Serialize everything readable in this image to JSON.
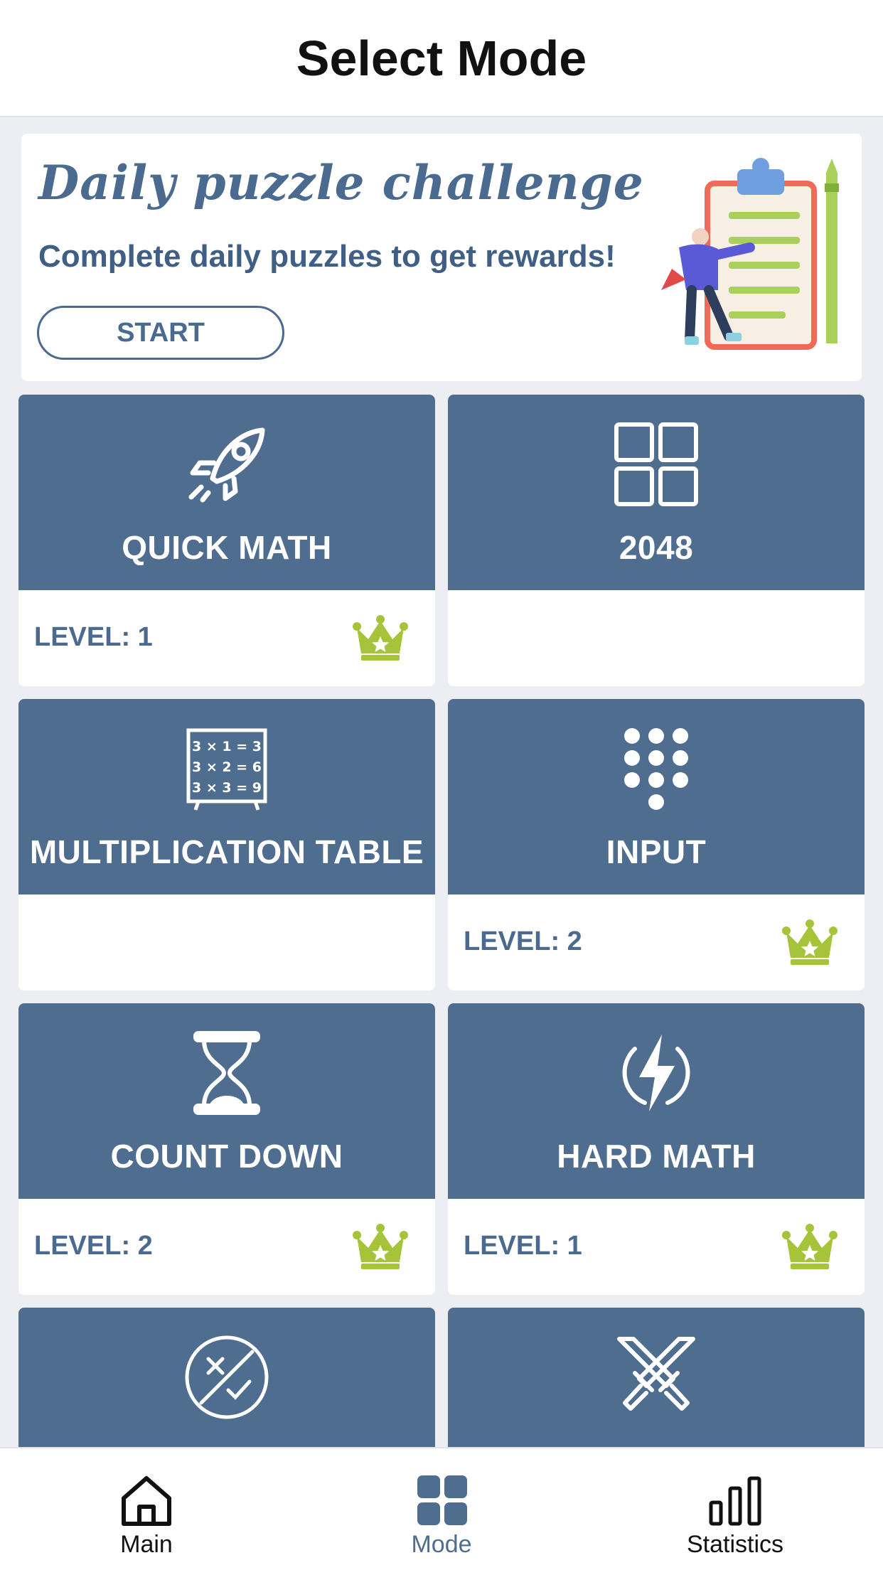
{
  "header": {
    "title": "Select Mode"
  },
  "banner": {
    "title": "Daily puzzle challenge",
    "subtitle": "Complete daily puzzles to get rewards!",
    "start_label": "START"
  },
  "colors": {
    "tile": "#4f6d8f",
    "accent_crown": "#a5c43a",
    "text_blue": "#4a6a8f"
  },
  "modes": [
    {
      "name": "QUICK MATH",
      "icon": "rocket-icon",
      "level": "LEVEL: 1",
      "crown": true
    },
    {
      "name": "2048",
      "icon": "grid-icon",
      "level": "",
      "crown": false
    },
    {
      "name": "MULTIPLICATION TABLE",
      "icon": "multiplication-board-icon",
      "level": "",
      "crown": false
    },
    {
      "name": "INPUT",
      "icon": "keypad-icon",
      "level": "LEVEL: 2",
      "crown": true
    },
    {
      "name": "COUNT DOWN",
      "icon": "hourglass-icon",
      "level": "LEVEL: 2",
      "crown": true
    },
    {
      "name": "HARD MATH",
      "icon": "lightning-icon",
      "level": "LEVEL: 1",
      "crown": true
    },
    {
      "name": "",
      "icon": "true-false-icon",
      "level": "",
      "crown": false
    },
    {
      "name": "",
      "icon": "crossed-swords-icon",
      "level": "",
      "crown": false
    }
  ],
  "board_lines": [
    "3 × 1 = 3",
    "3 × 2 = 6",
    "3 × 3 = 9"
  ],
  "tabs": [
    {
      "label": "Main",
      "icon": "home-icon",
      "active": false
    },
    {
      "label": "Mode",
      "icon": "grid-tiles-icon",
      "active": true
    },
    {
      "label": "Statistics",
      "icon": "bar-chart-icon",
      "active": false
    }
  ]
}
